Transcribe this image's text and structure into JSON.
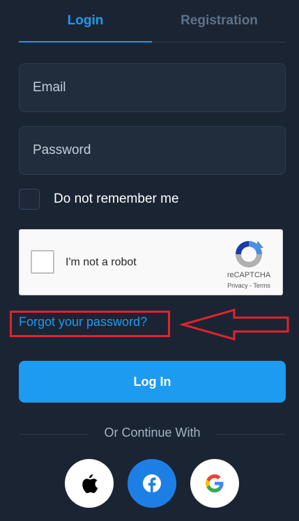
{
  "tabs": {
    "login": "Login",
    "registration": "Registration"
  },
  "form": {
    "email_placeholder": "Email",
    "password_placeholder": "Password",
    "remember_label": "Do not remember me"
  },
  "recaptcha": {
    "label": "I'm not a robot",
    "brand": "reCAPTCHA",
    "links": "Privacy - Terms"
  },
  "forgot_password": "Forgot your password?",
  "login_button": "Log In",
  "divider_text": "Or Continue With",
  "socials": {
    "apple": "apple-icon",
    "facebook": "facebook-icon",
    "google": "google-icon"
  },
  "colors": {
    "accent": "#1d9bf0",
    "background": "#1b2433",
    "highlight": "#e0232e",
    "facebook": "#1d7fe6"
  }
}
